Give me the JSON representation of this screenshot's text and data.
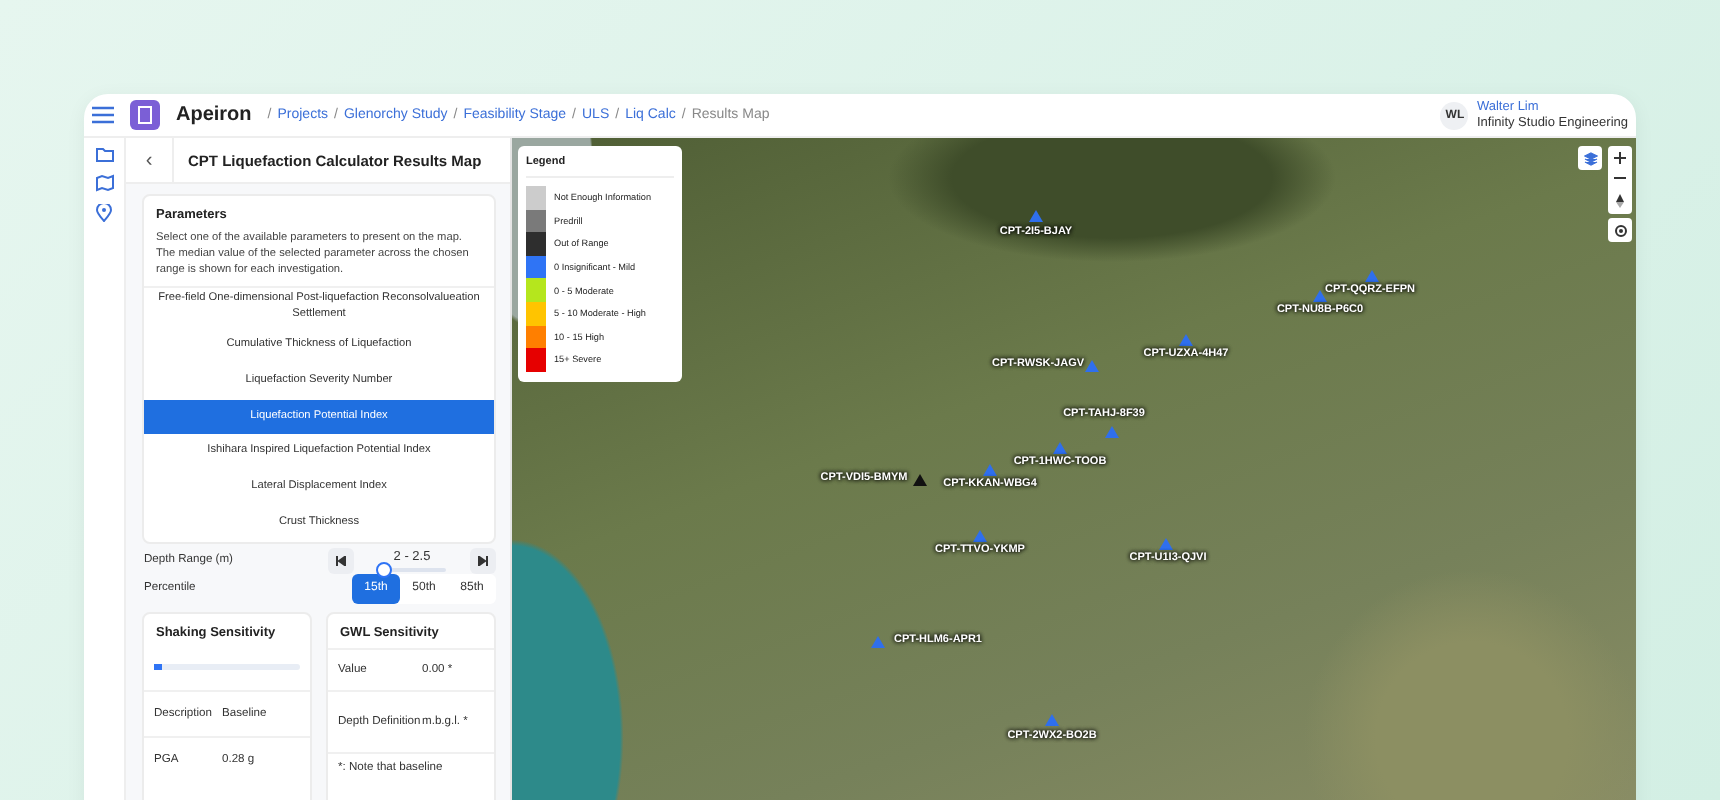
{
  "app": {
    "name": "Apeiron"
  },
  "breadcrumb": [
    {
      "separator": "/",
      "label": "Projects",
      "link": true
    },
    {
      "separator": "/",
      "label": "Glenorchy Study",
      "link": true
    },
    {
      "separator": "/",
      "label": "Feasibility Stage",
      "link": true
    },
    {
      "separator": "/",
      "label": "ULS",
      "link": true
    },
    {
      "separator": "/",
      "label": "Liq Calc",
      "link": true
    },
    {
      "separator": "/",
      "label": "Results Map",
      "link": false
    }
  ],
  "user": {
    "initials": "WL",
    "name": "Walter Lim",
    "company": "Infinity Studio Engineering"
  },
  "panel": {
    "back": "‹",
    "title": "CPT Liquefaction Calculator Results Map"
  },
  "parameters": {
    "title": "Parameters",
    "description": "Select one of the available parameters to present on the map. The median value of the selected parameter across the chosen range is shown for each investigation.",
    "options": [
      {
        "label": "Free-field One-dimensional Post-liquefaction Reconsolvalueation Settlement",
        "selected": false
      },
      {
        "label": "Cumulative Thickness of Liquefaction",
        "selected": false
      },
      {
        "label": "Liquefaction Severity Number",
        "selected": false
      },
      {
        "label": "Liquefaction Potential Index",
        "selected": true
      },
      {
        "label": "Ishihara Inspired Liquefaction Potential Index",
        "selected": false
      },
      {
        "label": "Lateral Displacement Index",
        "selected": false
      },
      {
        "label": "Crust Thickness",
        "selected": false
      }
    ]
  },
  "depth_range": {
    "label": "Depth Range (m)",
    "value": "2 - 2.5",
    "level": 0.1
  },
  "percentile": {
    "label": "Percentile",
    "options": [
      {
        "label": "15th",
        "selected": true
      },
      {
        "label": "50th",
        "selected": false
      },
      {
        "label": "85th",
        "selected": false
      }
    ]
  },
  "shaking": {
    "title": "Shaking Sensitivity",
    "level": 0.05,
    "rows": [
      {
        "label": "Description",
        "value": "Baseline"
      },
      {
        "label": "PGA",
        "value": "0.28 g"
      }
    ]
  },
  "gwl": {
    "title": "GWL Sensitivity",
    "rows": [
      {
        "label": "Value",
        "value": "0.00 *"
      },
      {
        "label": "Depth Definition",
        "value": "m.b.g.l. *"
      }
    ],
    "note": "*: Note that baseline"
  },
  "legend": {
    "title": "Legend",
    "items": [
      {
        "label": "Not Enough Information",
        "color": "#cccccc"
      },
      {
        "label": "Predrill",
        "color": "#7a7a7a"
      },
      {
        "label": "Out of Range",
        "color": "#2e2e2e"
      },
      {
        "label": "0 Insignificant - Mild",
        "color": "#2f74f5"
      },
      {
        "label": "0 - 5 Moderate",
        "color": "#b5e61d"
      },
      {
        "label": "5 - 10 Moderate - High",
        "color": "#ffc400"
      },
      {
        "label": "10 - 15 High",
        "color": "#ff7f00"
      },
      {
        "label": "15+ Severe",
        "color": "#e60000"
      }
    ]
  },
  "pins": [
    {
      "label": "CPT-2I5-BJAY",
      "color": "#2f6fed"
    },
    {
      "label": "CPT-QQRZ-EFPN",
      "color": "#2f6fed"
    },
    {
      "label": "CPT-NU8B-P6C0",
      "color": "#2f6fed"
    },
    {
      "label": "CPT-UZXA-4H47",
      "color": "#2f6fed"
    },
    {
      "label": "CPT-RWSK-JAGV",
      "color": "#2f6fed"
    },
    {
      "label": "CPT-TAHJ-8F39",
      "color": "#2f6fed"
    },
    {
      "label": "CPT-1HWC-TOOB",
      "color": "#2f6fed"
    },
    {
      "label": "CPT-KKAN-WBG4",
      "color": "#2f6fed"
    },
    {
      "label": "CPT-VDI5-BMYM",
      "color": "#111111"
    },
    {
      "label": "CPT-TTVO-YKMP",
      "color": "#2f6fed"
    },
    {
      "label": "CPT-U1I3-QJVI",
      "color": "#2f6fed"
    },
    {
      "label": "CPT-HLM6-APR1",
      "color": "#2f6fed"
    },
    {
      "label": "CPT-2WX2-BO2B",
      "color": "#2f6fed"
    }
  ]
}
